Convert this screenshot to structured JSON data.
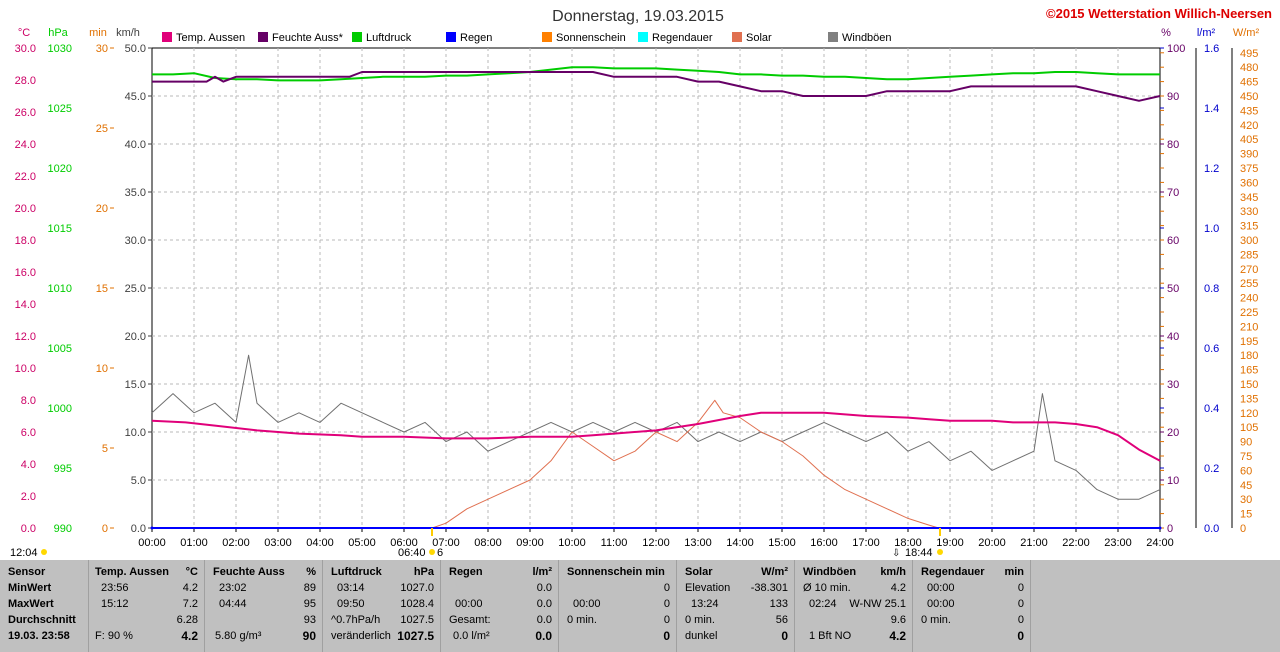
{
  "chart_data": {
    "type": "line",
    "title": "Donnerstag, 19.03.2015",
    "copyright": "©2015 Wetterstation Willich-Neersen",
    "x_ticks": [
      "00:00",
      "01:00",
      "02:00",
      "03:00",
      "04:00",
      "05:00",
      "06:00",
      "07:00",
      "08:00",
      "09:00",
      "10:00",
      "11:00",
      "12:00",
      "13:00",
      "14:00",
      "15:00",
      "16:00",
      "17:00",
      "18:00",
      "19:00",
      "20:00",
      "21:00",
      "22:00",
      "23:00",
      "24:00"
    ],
    "xlim": [
      0,
      24
    ],
    "axes": {
      "temp": {
        "unit": "°C",
        "ticks": [
          "30.0",
          "28.0",
          "26.0",
          "24.0",
          "22.0",
          "20.0",
          "18.0",
          "16.0",
          "14.0",
          "12.0",
          "10.0",
          "8.0",
          "6.0",
          "4.0",
          "2.0",
          "0.0"
        ],
        "range": [
          0,
          30
        ],
        "color": "#cc0066"
      },
      "pressure": {
        "unit": "hPa",
        "ticks": [
          "1030",
          "1025",
          "1020",
          "1015",
          "1010",
          "1005",
          "1000",
          "995",
          "990"
        ],
        "range": [
          990,
          1030
        ],
        "color": "#00cc00"
      },
      "minutes": {
        "unit": "min",
        "ticks": [
          "30",
          "25",
          "20",
          "15",
          "10",
          "5",
          "0"
        ],
        "range": [
          0,
          30
        ],
        "color": "#e07000"
      },
      "wind": {
        "unit": "km/h",
        "ticks": [
          "50.0",
          "45.0",
          "40.0",
          "35.0",
          "30.0",
          "25.0",
          "20.0",
          "15.0",
          "10.0",
          "5.0",
          "0.0"
        ],
        "range": [
          0,
          50
        ],
        "color": "#404040"
      },
      "humidity": {
        "unit": "%",
        "ticks": [
          "100",
          "90",
          "80",
          "70",
          "60",
          "50",
          "40",
          "30",
          "20",
          "10",
          "0"
        ],
        "range": [
          0,
          100
        ],
        "color": "#660066"
      },
      "rain": {
        "unit": "l/m²",
        "ticks": [
          "1.6",
          "1.4",
          "1.2",
          "1.0",
          "0.8",
          "0.6",
          "0.4",
          "0.2",
          "0.0"
        ],
        "range": [
          0,
          1.6
        ],
        "color": "#0000cc"
      },
      "solar": {
        "unit": "W/m²",
        "ticks": [
          "495",
          "480",
          "465",
          "450",
          "435",
          "420",
          "405",
          "390",
          "375",
          "360",
          "345",
          "330",
          "315",
          "300",
          "285",
          "270",
          "255",
          "240",
          "225",
          "210",
          "195",
          "180",
          "165",
          "150",
          "135",
          "120",
          "105",
          "90",
          "75",
          "60",
          "45",
          "30",
          "15",
          "0"
        ],
        "range": [
          0,
          500
        ],
        "color": "#e07000"
      }
    },
    "legend": [
      {
        "name": "Temp. Aussen",
        "color": "#e0007a"
      },
      {
        "name": "Feuchte Auss*",
        "color": "#660066"
      },
      {
        "name": "Luftdruck",
        "color": "#00cc00"
      },
      {
        "name": "Regen",
        "color": "#0000ff"
      },
      {
        "name": "Sonnenschein",
        "color": "#ff8000"
      },
      {
        "name": "Regendauer",
        "color": "#00ffff"
      },
      {
        "name": "Solar",
        "color": "#e07050"
      },
      {
        "name": "Windböen",
        "color": "#808080"
      }
    ],
    "series": [
      {
        "name": "Temp. Aussen",
        "axis": "temp",
        "x": [
          0,
          0.8,
          1.5,
          2.5,
          3.5,
          4.5,
          5,
          6,
          7,
          8,
          9,
          10,
          10.5,
          11,
          12,
          13,
          14,
          14.5,
          15,
          16,
          16.5,
          17,
          18,
          18.5,
          19,
          20,
          20.5,
          21,
          21.5,
          22,
          22.5,
          23,
          23.5,
          24
        ],
        "values": [
          6.7,
          6.6,
          6.4,
          6.1,
          5.9,
          5.8,
          5.7,
          5.7,
          5.6,
          5.6,
          5.7,
          5.7,
          5.8,
          5.9,
          6.1,
          6.5,
          7.0,
          7.2,
          7.2,
          7.2,
          7.1,
          7.0,
          6.9,
          6.8,
          6.7,
          6.7,
          6.6,
          6.6,
          6.6,
          6.5,
          6.3,
          5.8,
          4.9,
          4.2
        ]
      },
      {
        "name": "Feuchte Auss*",
        "axis": "humidity",
        "x": [
          0,
          1.3,
          1.5,
          1.7,
          2,
          3,
          4,
          4.7,
          5,
          6,
          7,
          8,
          9,
          10,
          10.5,
          11,
          11.5,
          12,
          12.5,
          13,
          13.5,
          14,
          14.5,
          15,
          15.5,
          16,
          17,
          17.5,
          18,
          19,
          19.5,
          20,
          21,
          22,
          22.5,
          23,
          23.5,
          24
        ],
        "values": [
          93,
          93,
          94,
          93,
          94,
          94,
          94,
          94,
          95,
          95,
          95,
          95,
          95,
          95,
          95,
          94,
          94,
          94,
          94,
          93,
          93,
          92,
          91,
          91,
          90,
          90,
          90,
          91,
          91,
          91,
          92,
          92,
          92,
          92,
          91,
          90,
          89,
          90
        ]
      },
      {
        "name": "Luftdruck",
        "axis": "pressure",
        "x": [
          0,
          0.5,
          1,
          1.5,
          2,
          2.5,
          3,
          3.5,
          4,
          4.5,
          5,
          5.5,
          6,
          6.5,
          7,
          7.5,
          8,
          8.5,
          9,
          9.5,
          10,
          10.5,
          11,
          11.5,
          12,
          12.5,
          13,
          13.5,
          14,
          14.5,
          15,
          15.5,
          16,
          16.5,
          17,
          17.5,
          18,
          18.5,
          19,
          19.5,
          20,
          20.5,
          21,
          21.5,
          22,
          22.5,
          23,
          23.5,
          24
        ],
        "values": [
          1027.8,
          1027.8,
          1027.9,
          1027.5,
          1027.4,
          1027.4,
          1027.3,
          1027.3,
          1027.3,
          1027.4,
          1027.5,
          1027.6,
          1027.6,
          1027.6,
          1027.7,
          1027.7,
          1027.8,
          1027.9,
          1028.0,
          1028.2,
          1028.4,
          1028.4,
          1028.3,
          1028.3,
          1028.3,
          1028.2,
          1028.1,
          1028.0,
          1027.8,
          1027.8,
          1027.7,
          1027.7,
          1027.6,
          1027.6,
          1027.5,
          1027.4,
          1027.4,
          1027.5,
          1027.6,
          1027.7,
          1027.8,
          1027.9,
          1027.9,
          1028.0,
          1028.0,
          1027.9,
          1027.8,
          1027.8,
          1027.8
        ]
      },
      {
        "name": "Solar",
        "axis": "solar",
        "x": [
          6.67,
          7,
          7.5,
          8,
          8.5,
          9,
          9.5,
          10,
          10.5,
          11,
          11.5,
          12,
          12.5,
          13,
          13.4,
          13.6,
          14,
          14.5,
          15,
          15.5,
          16,
          16.5,
          17,
          17.5,
          18,
          18.5,
          18.73
        ],
        "values": [
          0,
          5,
          20,
          30,
          40,
          50,
          70,
          100,
          85,
          70,
          80,
          100,
          90,
          110,
          133,
          120,
          115,
          100,
          90,
          75,
          55,
          40,
          30,
          20,
          10,
          3,
          0
        ]
      },
      {
        "name": "Windböen",
        "axis": "wind",
        "x": [
          0,
          0.5,
          1,
          1.5,
          2,
          2.3,
          2.5,
          3,
          3.5,
          4,
          4.5,
          5,
          5.5,
          6,
          6.5,
          7,
          7.5,
          8,
          8.5,
          9,
          9.5,
          10,
          10.5,
          11,
          11.5,
          12,
          12.5,
          13,
          13.5,
          14,
          14.5,
          15,
          15.5,
          16,
          16.5,
          17,
          17.5,
          18,
          18.5,
          19,
          19.5,
          20,
          20.5,
          21,
          21.2,
          21.5,
          22,
          22.5,
          23,
          23.5,
          24
        ],
        "values": [
          12,
          14,
          12,
          13,
          11,
          18,
          13,
          11,
          12,
          11,
          13,
          12,
          11,
          10,
          11,
          9,
          10,
          8,
          9,
          10,
          11,
          10,
          11,
          10,
          11,
          10,
          11,
          9,
          10,
          9,
          10,
          9,
          10,
          11,
          10,
          9,
          10,
          8,
          9,
          7,
          8,
          6,
          7,
          8,
          14,
          7,
          6,
          4,
          3,
          3,
          4
        ]
      },
      {
        "name": "Regen",
        "axis": "rain",
        "x": [
          0,
          24
        ],
        "values": [
          0,
          0
        ]
      }
    ],
    "markers": {
      "left": "12:04",
      "sunrise": "06:40",
      "sunset": "18:44",
      "sunrise_suffix": "6"
    }
  },
  "footer": {
    "rows": [
      "Sensor",
      "MinWert",
      "MaxWert",
      "Durchschnitt",
      "19.03.  23:58"
    ],
    "temp": {
      "title": "Temp. Aussen",
      "unit": "°C",
      "min_time": "23:56",
      "min": "4.2",
      "max_time": "15:12",
      "max": "7.2",
      "avg": "6.28",
      "cur_label": "F: 90 %",
      "cur": "4.2"
    },
    "humidity": {
      "title": "Feuchte Auss",
      "unit": "%",
      "min_time": "23:02",
      "min": "89",
      "max_time": "04:44",
      "max": "95",
      "avg": "93",
      "cur_label": "5.80 g/m³",
      "cur": "90"
    },
    "pressure": {
      "title": "Luftdruck",
      "unit": "hPa",
      "min_time": "03:14",
      "min": "1027.0",
      "max_time": "09:50",
      "max": "1028.4",
      "avg_label": "^0.7hPa/h",
      "avg": "1027.5",
      "cur_label": "veränderlich",
      "cur": "1027.5"
    },
    "rain": {
      "title": "Regen",
      "unit": "l/m²",
      "min": "0.0",
      "max_time": "00:00",
      "max": "0.0",
      "avg_label": "Gesamt:",
      "avg": "0.0",
      "cur_label": "0.0 l/m²",
      "cur": "0.0"
    },
    "sunshine": {
      "title": "Sonnenschein min",
      "min": "0",
      "max_time": "00:00",
      "max": "0",
      "avg_label": "0 min.",
      "avg": "0",
      "cur": "0"
    },
    "solar": {
      "title": "Solar",
      "unit": "W/m²",
      "min_label": "Elevation",
      "min": "-38.301",
      "max_time": "13:24",
      "max": "133",
      "avg_label": "0 min.",
      "avg": "56",
      "cur_label": "dunkel",
      "cur": "0"
    },
    "wind": {
      "title": "Windböen",
      "unit": "km/h",
      "min_label": "Ø 10 min.",
      "min": "4.2",
      "max_time": "02:24",
      "max": "W-NW 25.1",
      "avg": "9.6",
      "cur_label": "1 Bft NO",
      "cur": "4.2"
    },
    "rainduration": {
      "title": "Regendauer",
      "unit": "min",
      "min_time": "00:00",
      "min": "0",
      "max_time": "00:00",
      "max": "0",
      "avg_label": "0 min.",
      "avg": "0",
      "cur": "0"
    }
  }
}
